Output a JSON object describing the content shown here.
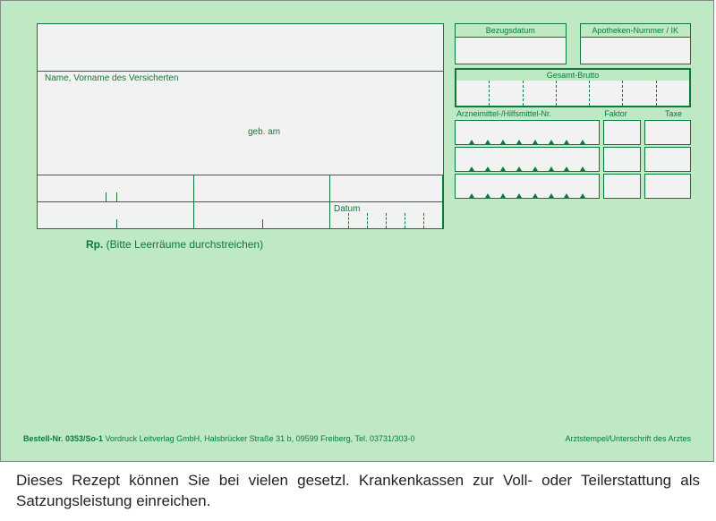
{
  "labels": {
    "name": "Name, Vorname des Versicherten",
    "geb_am": "geb. am",
    "datum": "Datum",
    "rp": "Rp.",
    "rp_note": " (Bitte Leerräume durchstreichen)",
    "bezugsdatum": "Bezugsdatum",
    "apotheken": "Apotheken-Nummer / IK",
    "gesamt_brutto": "Gesamt-Brutto",
    "arzneimittel": "Arzneimittel-/Hilfsmittel-Nr.",
    "faktor": "Faktor",
    "taxe": "Taxe",
    "arztstempel": "Arztstempel/Unterschrift des Arztes"
  },
  "footer": {
    "bestell_label": "Bestell-Nr. 0353/So-1",
    "publisher": " Vordruck Leitverlag GmbH, Halsbrücker Straße 31 b, 09599 Freiberg, Tel. 03731/303-0"
  },
  "note": "Dieses Rezept können Sie bei vielen gesetzl. Krankenkassen zur Voll- oder Teilerstattung als Satzungsleistung einreichen."
}
